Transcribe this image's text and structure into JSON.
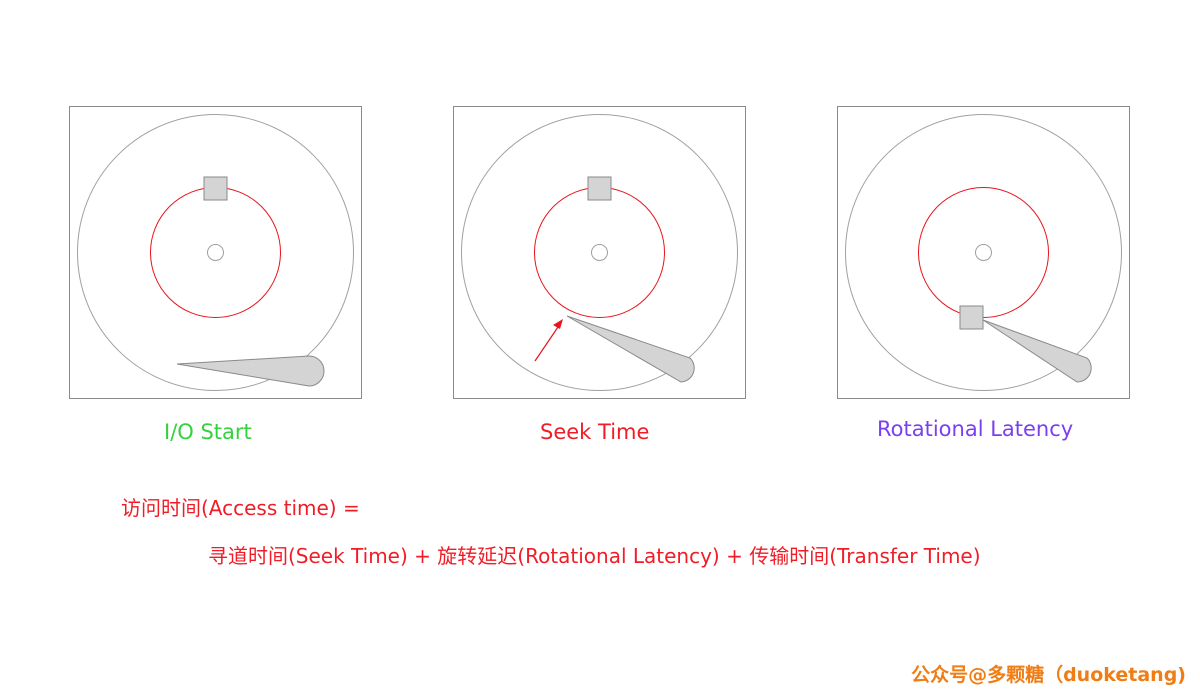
{
  "panels": [
    {
      "caption": "I/O Start",
      "caption_color": "#33d33d"
    },
    {
      "caption": "Seek Time",
      "caption_color": "#f01d27"
    },
    {
      "caption": "Rotational Latency",
      "caption_color": "#7a3ff0"
    }
  ],
  "formula": {
    "line1": "访问时间(Access time) =",
    "line2": "寻道时间(Seek Time) + 旋转延迟(Rotational Latency) + 传输时间(Transfer Time)"
  },
  "watermark": "公众号@多颗糖（duoketang)",
  "colors": {
    "platter": "#a0a0a0",
    "track": "#e8141e",
    "block": "#cfcfcf",
    "arrow": "#e8141e"
  }
}
